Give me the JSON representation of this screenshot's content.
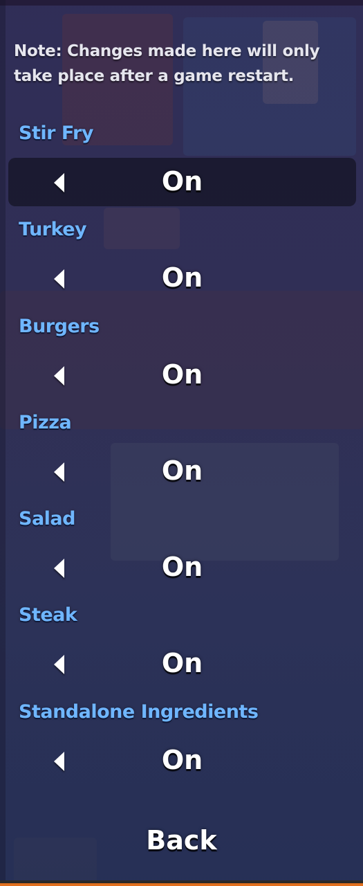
{
  "menu": {
    "note": "Note: Changes made here will only take place after a game restart.",
    "options": [
      {
        "label": "Stir Fry",
        "value": "On",
        "selected": true
      },
      {
        "label": "Turkey",
        "value": "On",
        "selected": false
      },
      {
        "label": "Burgers",
        "value": "On",
        "selected": false
      },
      {
        "label": "Pizza",
        "value": "On",
        "selected": false
      },
      {
        "label": "Salad",
        "value": "On",
        "selected": false
      },
      {
        "label": "Steak",
        "value": "On",
        "selected": false
      },
      {
        "label": "Standalone Ingredients",
        "value": "On",
        "selected": false
      }
    ],
    "back_label": "Back"
  },
  "colors": {
    "label": "#6fb6ff",
    "value": "#ffffff",
    "note": "#e6e6ee",
    "selected_row": "#14142380"
  }
}
